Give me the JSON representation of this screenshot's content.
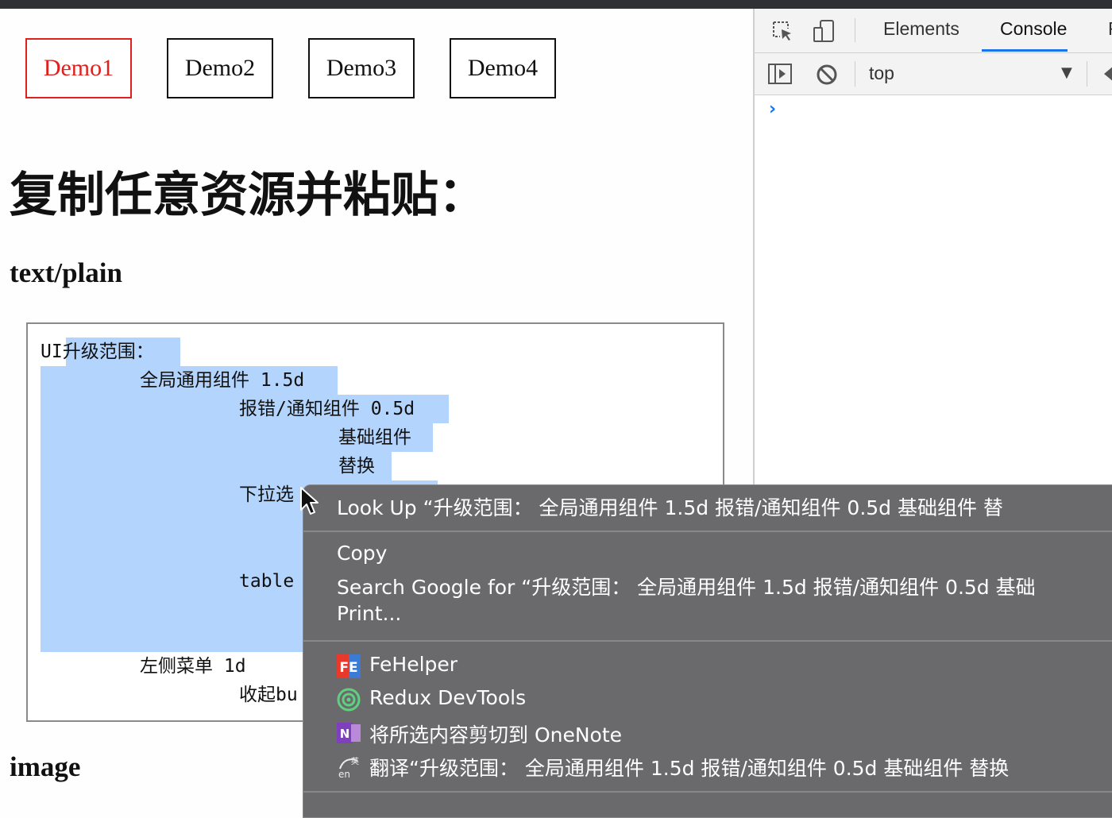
{
  "page": {
    "demo_buttons": [
      "Demo1",
      "Demo2",
      "Demo3",
      "Demo4"
    ],
    "active_demo": "Demo1",
    "title": "复制任意资源并粘贴：",
    "section_text": "text/plain",
    "section_image": "image",
    "paste_lines": [
      "UI升级范围：",
      "全局通用组件 1.5d",
      "报错/通知组件 0.5d",
      "基础组件",
      "替换",
      "下拉选",
      "table",
      "左侧菜单 1d",
      "收起bu"
    ]
  },
  "devtools": {
    "tabs": [
      "Elements",
      "Console",
      "F"
    ],
    "active_tab": "Console",
    "context": "top",
    "prompt_symbol": "›",
    "accent_color": "#1a73e8"
  },
  "context_menu": {
    "look_up": "Look Up “升级范围：   全局通用组件 1.5d   报错/通知组件 0.5d   基础组件   替",
    "copy": "Copy",
    "search_google": "Search Google for “升级范围：   全局通用组件 1.5d   报错/通知组件 0.5d   基础",
    "print": "Print...",
    "extensions": [
      {
        "label": "FeHelper",
        "icon": "fehelper-icon"
      },
      {
        "label": "Redux DevTools",
        "icon": "redux-devtools-icon"
      },
      {
        "label": "将所选内容剪切到 OneNote",
        "icon": "onenote-icon"
      },
      {
        "label": "翻译“升级范围：   全局通用组件 1.5d   报错/通知组件 0.5d   基础组件   替换",
        "icon": "translate-icon"
      }
    ]
  }
}
